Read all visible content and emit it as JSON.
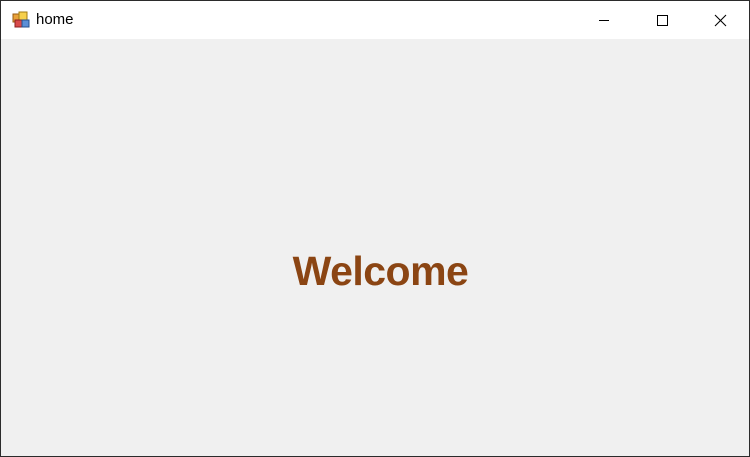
{
  "window": {
    "title": "home",
    "app_icon": "app-icon",
    "controls": {
      "minimize_icon": "minimize-icon",
      "maximize_icon": "maximize-icon",
      "close_icon": "close-icon"
    }
  },
  "content": {
    "welcome_text": "Welcome",
    "welcome_color": "#8b4513",
    "background_color": "#f0f0f0"
  }
}
